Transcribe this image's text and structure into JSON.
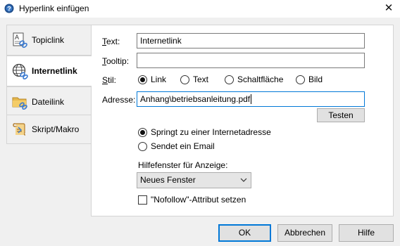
{
  "window": {
    "title": "Hyperlink einfügen",
    "close_label": "✕"
  },
  "tabs": [
    {
      "label": "Topiclink",
      "icon": "topic-link-icon",
      "active": false
    },
    {
      "label": "Internetlink",
      "icon": "globe-link-icon",
      "active": true
    },
    {
      "label": "Dateilink",
      "icon": "folder-link-icon",
      "active": false
    },
    {
      "label": "Skript/Makro",
      "icon": "script-icon",
      "active": false
    }
  ],
  "form": {
    "text_label": "Text:",
    "text_value": "Internetlink",
    "tooltip_label": "Tooltip:",
    "tooltip_value": "",
    "stil_label": "Stil:",
    "stil_options": [
      "Link",
      "Text",
      "Schaltfläche",
      "Bild"
    ],
    "stil_selected": "Link",
    "adresse_label": "Adresse:",
    "adresse_value": "Anhang\\betriebsanleitung.pdf",
    "testen_label": "Testen",
    "target_options": [
      "Springt zu einer Internetadresse",
      "Sendet ein Email"
    ],
    "target_selected": "Springt zu einer Internetadresse",
    "hilfefenster_label": "Hilfefenster für Anzeige:",
    "hilfefenster_value": "Neues Fenster",
    "nofollow_label": "\"Nofollow\"-Attribut setzen",
    "nofollow_checked": false
  },
  "buttons": {
    "ok": "OK",
    "abbrechen": "Abbrechen",
    "hilfe": "Hilfe"
  },
  "colors": {
    "accent": "#0078d7",
    "panel_bg": "#ffffff",
    "dialog_bg": "#f0f0f0"
  }
}
